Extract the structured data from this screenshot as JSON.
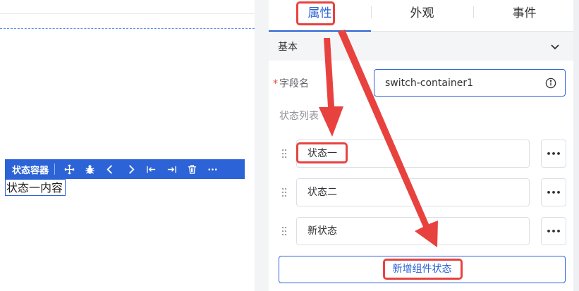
{
  "canvas": {
    "toolbar": {
      "title": "状态容器",
      "icons": [
        "move-icon",
        "bug-icon",
        "chevron-left-icon",
        "chevron-right-icon",
        "move-to-start-icon",
        "move-to-end-icon",
        "delete-icon",
        "more-icon"
      ]
    },
    "content_text": "状态一内容"
  },
  "panel": {
    "tabs": [
      {
        "label": "属性",
        "active": true
      },
      {
        "label": "外观",
        "active": false
      },
      {
        "label": "事件",
        "active": false
      }
    ],
    "section_title": "基本",
    "field": {
      "required_mark": "*",
      "label": "字段名",
      "value": "switch-container1"
    },
    "state_list_label": "状态列表",
    "states": [
      {
        "label": "状态一"
      },
      {
        "label": "状态二"
      },
      {
        "label": "新状态"
      }
    ],
    "more_label": "•••",
    "add_button_label": "新增组件状态"
  },
  "colors": {
    "accent": "#2c63d6",
    "annotation": "#e8423f",
    "border": "#dcdfe6"
  }
}
